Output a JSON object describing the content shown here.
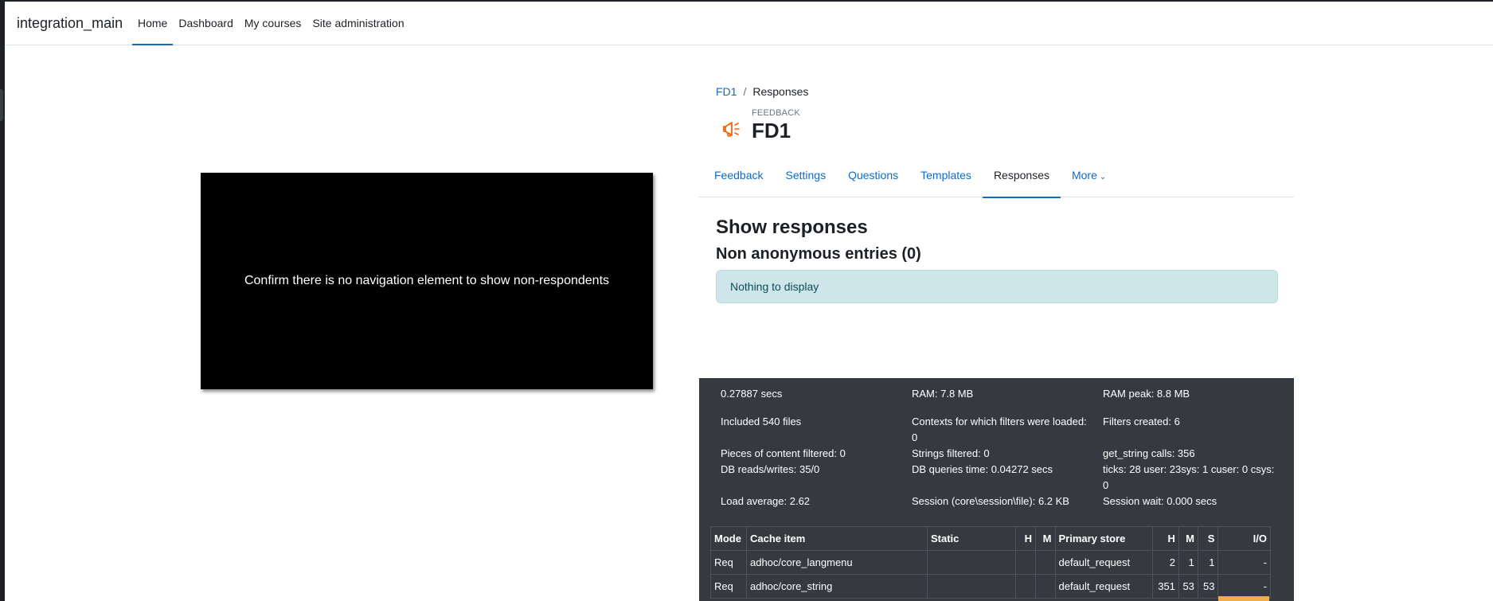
{
  "navbar": {
    "brand": "integration_main",
    "links": [
      {
        "label": "Home",
        "active": true
      },
      {
        "label": "Dashboard",
        "active": false
      },
      {
        "label": "My courses",
        "active": false
      },
      {
        "label": "Site administration",
        "active": false
      }
    ]
  },
  "overlay": {
    "text": "Confirm there is no navigation element to show non-respondents"
  },
  "breadcrumb": {
    "parent": "FD1",
    "separator": "/",
    "current": "Responses"
  },
  "activity": {
    "type": "FEEDBACK",
    "title": "FD1",
    "icon": "megaphone-icon",
    "icon_color": "#f7630c"
  },
  "tabs": [
    {
      "label": "Feedback",
      "active": false
    },
    {
      "label": "Settings",
      "active": false
    },
    {
      "label": "Questions",
      "active": false
    },
    {
      "label": "Templates",
      "active": false
    },
    {
      "label": "Responses",
      "active": true
    },
    {
      "label": "More",
      "active": false
    }
  ],
  "content": {
    "heading": "Show responses",
    "subheading": "Non anonymous entries (0)",
    "alert": "Nothing to display"
  },
  "perf": {
    "items": [
      "0.27887 secs",
      "RAM: 7.8 MB",
      "RAM peak: 8.8 MB",
      "Included 540 files",
      "Contexts for which filters were loaded: 0",
      "Filters created: 6",
      "Pieces of content filtered: 0",
      "Strings filtered: 0",
      "get_string calls: 356",
      "DB reads/writes: 35/0",
      "DB queries time: 0.04272 secs",
      "ticks: 28 user: 23sys: 1 cuser: 0 csys: 0",
      "Load average: 2.62",
      "Session (core\\session\\file): 6.2 KB",
      "Session wait: 0.000 secs"
    ],
    "table": {
      "headers": [
        "Mode",
        "Cache item",
        "Static",
        "H",
        "M",
        "Primary store",
        "H",
        "M",
        "S",
        "I/O"
      ],
      "rows": [
        [
          "Req",
          "adhoc/core_langmenu",
          "",
          "",
          "",
          "default_request",
          "2",
          "1",
          "1",
          "-"
        ],
        [
          "Req",
          "adhoc/core_string",
          "",
          "",
          "",
          "default_request",
          "351",
          "53",
          "53",
          "-"
        ]
      ]
    }
  },
  "colors": {
    "link": "#0f6cbf",
    "alert_bg": "#cee6ea",
    "perf_bg": "#343a40",
    "accent_orange": "#f0ad4e"
  }
}
